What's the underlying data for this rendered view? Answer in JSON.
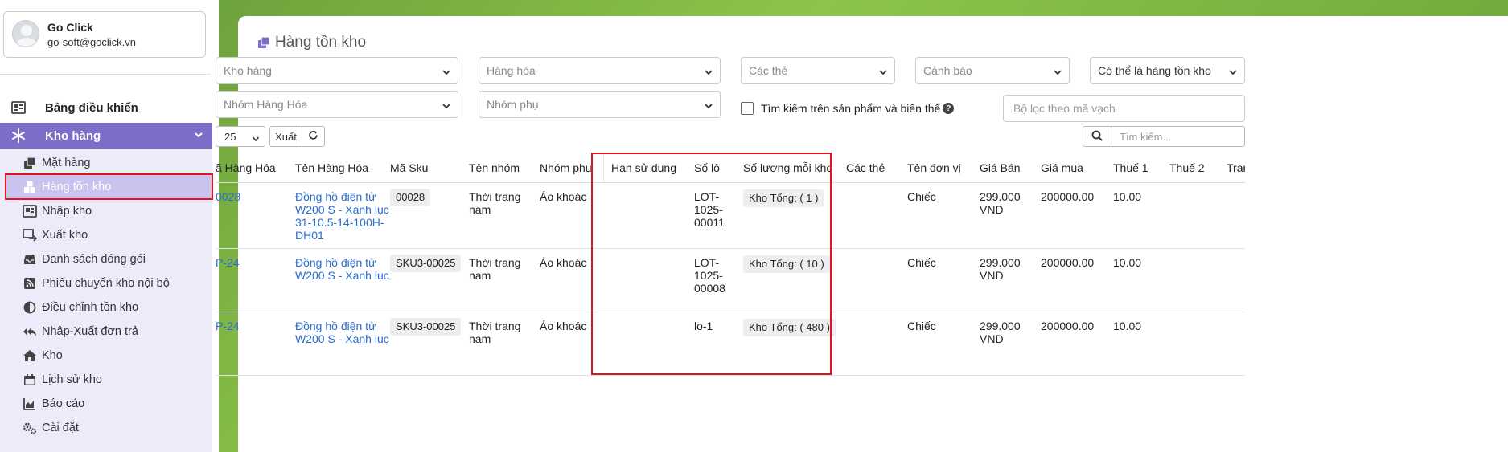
{
  "user": {
    "name": "Go Click",
    "email": "go-soft@goclick.vn"
  },
  "sidebar": {
    "dashboard_label": "Bảng điều khiển",
    "section_label": "Kho hàng",
    "items": [
      {
        "label": "Mặt hàng",
        "icon": "copy-icon"
      },
      {
        "label": "Hàng tồn kho",
        "icon": "boxes-icon",
        "active": true
      },
      {
        "label": "Nhập kho",
        "icon": "import-icon"
      },
      {
        "label": "Xuất kho",
        "icon": "export-icon"
      },
      {
        "label": "Danh sách đóng gói",
        "icon": "inbox-icon"
      },
      {
        "label": "Phiếu chuyển kho nội bộ",
        "icon": "rss-icon"
      },
      {
        "label": "Điều chỉnh tồn kho",
        "icon": "adjust-icon"
      },
      {
        "label": "Nhập-Xuất đơn trả",
        "icon": "reply-all-icon"
      },
      {
        "label": "Kho",
        "icon": "home-icon"
      },
      {
        "label": "Lịch sử kho",
        "icon": "calendar-icon"
      },
      {
        "label": "Báo cáo",
        "icon": "chart-icon"
      },
      {
        "label": "Cài đặt",
        "icon": "cogs-icon"
      }
    ]
  },
  "page": {
    "title": "Hàng tồn kho"
  },
  "filters": {
    "warehouse": "Kho hàng",
    "goods": "Hàng hóa",
    "tags": "Các thẻ",
    "alert": "Cảnh báo",
    "inventory_type": "Có thể là hàng tồn kho",
    "group": "Nhóm Hàng Hóa",
    "subgroup": "Nhóm phụ",
    "search_variants_label": "Tìm kiếm trên sản phẩm và biến thể",
    "barcode_placeholder": "Bộ lọc theo mã vạch"
  },
  "toolbar": {
    "page_size": "25",
    "export_label": "Xuất",
    "search_placeholder": "Tìm kiếm..."
  },
  "table": {
    "headers": {
      "code": "ã Hàng Hóa",
      "name": "Tên Hàng Hóa",
      "sku": "Mã Sku",
      "group": "Tên nhóm",
      "subgroup": "Nhóm phụ",
      "expiry": "Hạn sử dụng",
      "lot": "Số lô",
      "qty": "Số lượng mỗi kho",
      "tags": "Các thẻ",
      "unit": "Tên đơn vị",
      "price": "Giá Bán",
      "cost": "Giá mua",
      "tax1": "Thuế 1",
      "tax2": "Thuế 2",
      "status": "Trạn"
    },
    "rows": [
      {
        "code": "0028",
        "name_lines": [
          "Đồng hồ điện tử",
          "W200 S - Xanh lục",
          "31-10.5-14-100H-",
          "DH01"
        ],
        "sku": "00028",
        "group_lines": [
          "Thời trang",
          "nam"
        ],
        "subgroup": "Áo khoác",
        "expiry": "",
        "lot_lines": [
          "LOT-",
          "1025-",
          "00011"
        ],
        "qty": "Kho Tổng: ( 1 )",
        "unit": "Chiếc",
        "price_lines": [
          "299.000",
          "VND"
        ],
        "cost": "200000.00",
        "tax1": "10.00"
      },
      {
        "code": "P-24",
        "name_lines": [
          "Đồng hồ điện tử",
          "W200 S - Xanh lục"
        ],
        "sku": "SKU3-00025",
        "group_lines": [
          "Thời trang",
          "nam"
        ],
        "subgroup": "Áo khoác",
        "expiry": "",
        "lot_lines": [
          "LOT-",
          "1025-",
          "00008"
        ],
        "qty": "Kho Tổng: ( 10 )",
        "unit": "Chiếc",
        "price_lines": [
          "299.000",
          "VND"
        ],
        "cost": "200000.00",
        "tax1": "10.00"
      },
      {
        "code": "P-24",
        "name_lines": [
          "Đồng hồ điện tử",
          "W200 S - Xanh lục"
        ],
        "sku": "SKU3-00025",
        "group_lines": [
          "Thời trang",
          "nam"
        ],
        "subgroup": "Áo khoác",
        "expiry": "",
        "lot_lines": [
          "lo-1"
        ],
        "qty": "Kho Tổng: ( 480 )",
        "unit": "Chiếc",
        "price_lines": [
          "299.000",
          "VND"
        ],
        "cost": "200000.00",
        "tax1": "10.00"
      }
    ]
  },
  "colors": {
    "accent": "#7a6ec8",
    "link": "#2a6ccf",
    "highlight": "#e0141e",
    "active_bg": "#c8c4ee"
  }
}
